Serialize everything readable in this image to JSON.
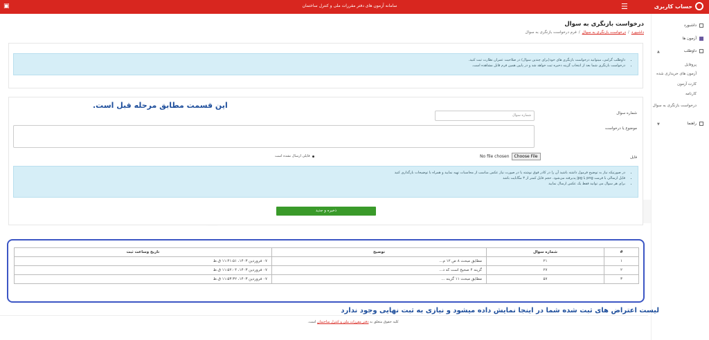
{
  "header": {
    "brand": "حساب کاربری",
    "center_text": "سامانه آزمون های دفتر مقررات ملی و کنترل ساختمان",
    "menu_icon": "hamburger-icon",
    "left_icon": "store-icon"
  },
  "sidebar": {
    "items": [
      {
        "label": "داشبورد",
        "icon": "dashboard-icon"
      },
      {
        "label": "آزمون ها",
        "icon": "exam-icon"
      },
      {
        "label": "داوطلب",
        "icon": "person-icon"
      }
    ],
    "sub_items": [
      {
        "label": "پروفایل"
      },
      {
        "label": "آزمون های خریداری شده"
      },
      {
        "label": "کارت آزمون"
      },
      {
        "label": "کارنامه"
      },
      {
        "label": "درخواست بازنگری به سوال"
      }
    ],
    "help": "راهنما"
  },
  "page": {
    "title": "درخواست بازنگری به سوال",
    "breadcrumb": {
      "home": "داشبورد",
      "parent": "درخواست بازنگری به سوال",
      "current": "فرم درخواست بازنگری به سوال"
    }
  },
  "info_alert": {
    "items": [
      "داوطلب گرامی، میتوانید درخواست بازنگری های خود(برای چندین سوال) در صلاحیت عمران نظارت ثبت کنید.",
      "درخواست بازنگری شما بعد از انتخاب گزینه ذخیره ثبت خواهد شد و در پایین همین فرم قابل مشاهده است."
    ]
  },
  "form": {
    "question_label": "شماره سوال",
    "question_placeholder": "شماره سوال",
    "subject_label": "موضوع یا درخواست",
    "file_label": "فایل",
    "file_button": "Choose File",
    "file_status": "No file chosen",
    "radio_label": "فایلی ارسال نشده است",
    "save_label": "ذخیره و جدید"
  },
  "form_alert": {
    "items": [
      "در صورتیکه نیاز به توضیح فرمول داشته باشید آن را در کادر فوق نوشته یا در صورت نیاز عکس مناسب از محاسبات تهیه نمایید و همراه با توضیحات بارگذاری کنید",
      "فایل ارسالی با فرمت png یا jpg پذیرفته می‌شود. حجم فایل کمتر از ۳ مگابایت باشد",
      "برای هر سوال می توانید فقط یک عکس ارسال نمایید"
    ]
  },
  "annotations": {
    "top": "این قسمت مطابق مرحله قبل است.",
    "bottom": "لیست اعتراض های ثبت شده شما در اینجا نمایش داده میشود و نیازی به ثبت نهایی وجود ندارد"
  },
  "table": {
    "headers": [
      "#",
      "شماره سوال",
      "توضیح",
      "تاریخ وساعت ثبت"
    ],
    "rows": [
      [
        "۱",
        "۲۱",
        "مطابق مبحث ۸ ص ۱۲ م...",
        "۰۷ فروردین ۱۴۰۳، ۱۱:۴۱:۵۱ ق.ظ"
      ],
      [
        "۲",
        "۲۷",
        "گزینه ۴ صحیح است که د...",
        "۰۷ فروردین ۱۴۰۳، ۱۱:۵۲:۰۴ ق.ظ"
      ],
      [
        "۳",
        "۵۷",
        "مطابق مبحث ۱۱ گزینه ...",
        "۰۷ فروردین ۱۴۰۳، ۱۱:۵۳:۳۲ ق.ظ"
      ]
    ]
  },
  "footer": {
    "text": "کلیه حقوق متعلق به",
    "link": "دفتر مقررات ملی و کنترل ساختمان",
    "suffix": "است."
  },
  "watermark": "ICIVIL",
  "colors": {
    "primary": "#d8261f",
    "save": "#3a9a2a",
    "annotation": "#1f4f9c",
    "highlight_border": "#3b55c4",
    "alert_bg": "#d6eef7"
  }
}
